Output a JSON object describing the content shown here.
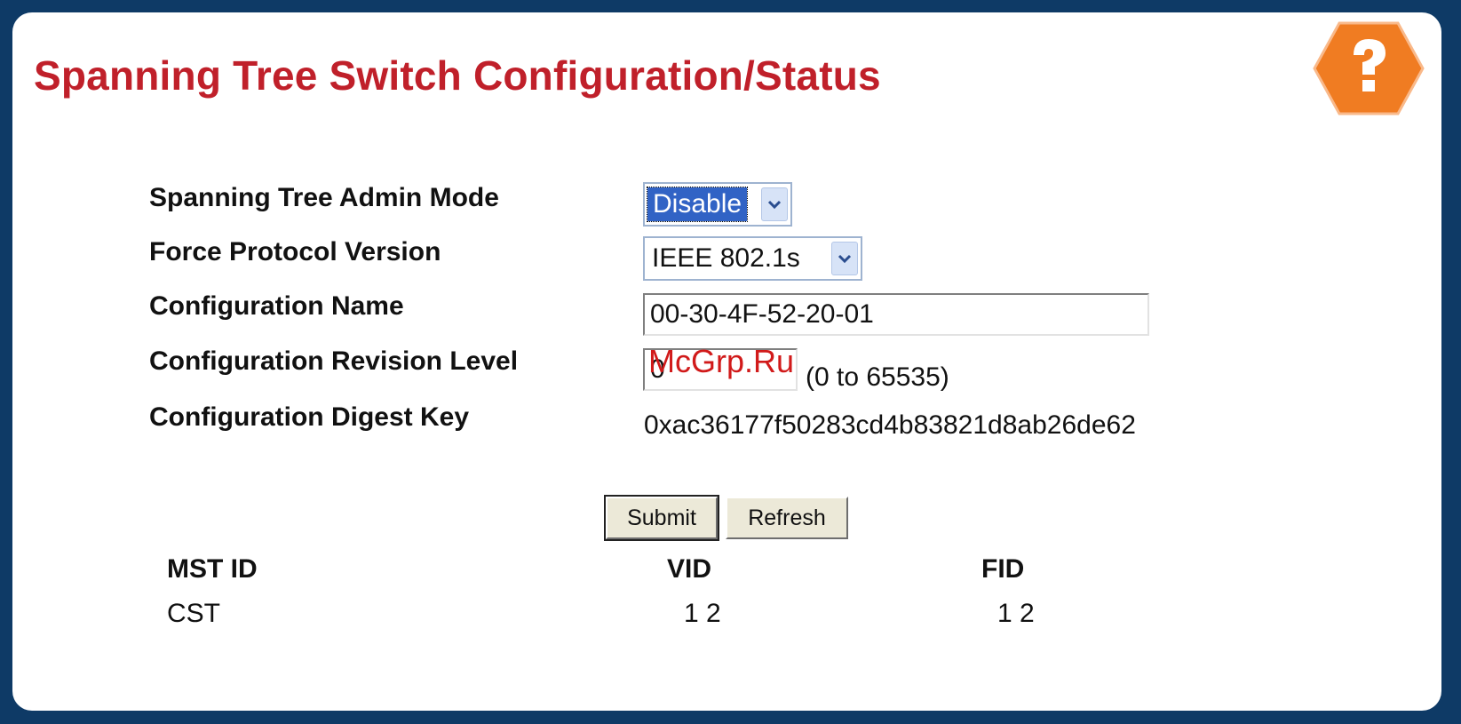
{
  "page": {
    "title": "Spanning Tree Switch Configuration/Status",
    "help_icon": "help-question-icon"
  },
  "form": {
    "admin_mode_label": "Spanning Tree Admin Mode",
    "admin_mode_value": "Disable",
    "protocol_label": "Force Protocol Version",
    "protocol_value": "IEEE 802.1s",
    "config_name_label": "Configuration Name",
    "config_name_value": "00-30-4F-52-20-01",
    "revision_label": "Configuration Revision Level",
    "revision_value": "0",
    "revision_hint": "(0 to 65535)",
    "digest_label": "Configuration Digest Key",
    "digest_value": "0xac36177f50283cd4b83821d8ab26de62"
  },
  "buttons": {
    "submit": "Submit",
    "refresh": "Refresh"
  },
  "table": {
    "headers": [
      "MST ID",
      "VID",
      "FID"
    ],
    "rows": [
      [
        "CST",
        "1 2",
        "1 2"
      ]
    ]
  },
  "watermark": "McGrp.Ru",
  "colors": {
    "title": "#c0202a",
    "frame": "#0e3a66",
    "help_icon": "#f07c22"
  }
}
